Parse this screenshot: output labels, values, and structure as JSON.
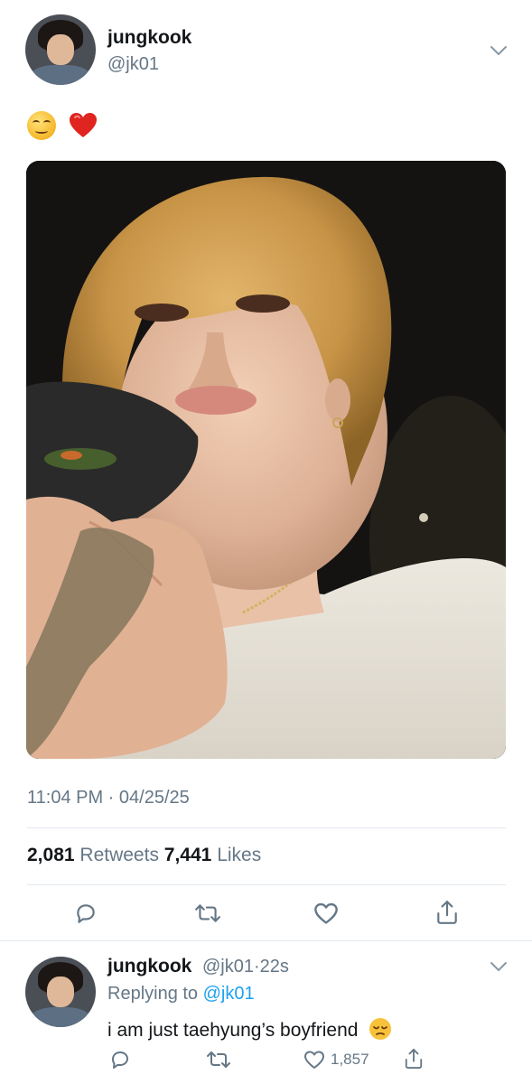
{
  "tweet": {
    "author_name": "jungkook",
    "author_handle": "@jk01",
    "text_emojis": [
      "smiling-face",
      "red-heart"
    ],
    "timestamp": "11:04 PM · 04/25/25",
    "retweets_count": "2,081",
    "retweets_label": "Retweets",
    "likes_count": "7,441",
    "likes_label": "Likes"
  },
  "reply": {
    "author_name": "jungkook",
    "author_handle": "@jk01",
    "age": "22s",
    "replying_to_label": "Replying to",
    "replying_to_handle": "@jk01",
    "text": "i am just taehyung’s boyfriend",
    "like_count": "1,857"
  },
  "icons": [
    "reply-icon",
    "retweet-icon",
    "like-icon",
    "share-icon",
    "chevron-down-icon"
  ],
  "colors": {
    "text": "#14171a",
    "secondary": "#657786",
    "link": "#1da1f2",
    "divider": "#e1e8ed"
  }
}
